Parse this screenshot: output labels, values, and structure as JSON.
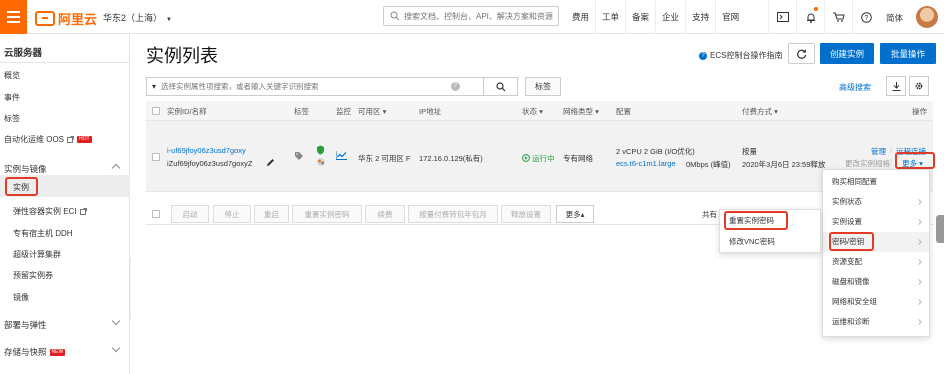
{
  "topbar": {
    "brand": "阿里云",
    "region": "华东2（上海）",
    "search_placeholder": "搜索文档、控制台、API、解决方案和资源",
    "nav": [
      "费用",
      "工单",
      "备案",
      "企业",
      "支持",
      "官网"
    ],
    "icons": [
      "terminal-icon",
      "bell-icon",
      "cart-icon",
      "help-icon"
    ],
    "lang": "简体"
  },
  "sidebar": {
    "title": "云服务器",
    "items": [
      {
        "label": "概览",
        "type": "item"
      },
      {
        "label": "事件",
        "type": "item"
      },
      {
        "label": "标签",
        "type": "item"
      },
      {
        "label": "自动化运维 OOS",
        "type": "item",
        "badge": "HOT",
        "external": true
      },
      {
        "label": "实例与镜像",
        "type": "group",
        "expanded": true
      },
      {
        "label": "实例",
        "type": "sub",
        "active": true
      },
      {
        "label": "弹性容器实例 ECI",
        "type": "sub",
        "external": true
      },
      {
        "label": "专有宿主机 DDH",
        "type": "sub"
      },
      {
        "label": "超级计算集群",
        "type": "sub"
      },
      {
        "label": "预留实例券",
        "type": "sub"
      },
      {
        "label": "镜像",
        "type": "sub"
      },
      {
        "label": "部署与弹性",
        "type": "group",
        "expanded": false
      },
      {
        "label": "存储与快照",
        "type": "group",
        "expanded": false,
        "badge": "NEW"
      }
    ]
  },
  "main": {
    "title": "实例列表",
    "guide_link": "ECS控制台操作指南",
    "create_btn": "创建实例",
    "batch_btn": "批量操作",
    "filter_placeholder": "选择实例属性项搜索，或者输入关键字识别搜索",
    "tag_btn": "标签",
    "advanced_search": "高级搜索"
  },
  "table": {
    "headers": {
      "id_name": "实例ID/名称",
      "tags": "标签",
      "monitor": "监控",
      "zone": "可用区",
      "ip": "IP地址",
      "status": "状态",
      "net_type": "网络类型",
      "config": "配置",
      "billing": "付费方式",
      "actions": "操作"
    },
    "row": {
      "instance_id": "i-uf69jfoy06z3usd7goxy",
      "instance_name": "iZuf69jfoy06z3usd7goxyZ",
      "zone": "华东 2 可用区 F",
      "ip": "172.16.0.129(私有)",
      "status": "运行中",
      "net_type": "专有网络",
      "config_line1": "2 vCPU 2 GiB (I/O优化)",
      "config_type": "ecs.t6-c1m1.large",
      "config_bw": "0Mbps (峰值)",
      "billing_type": "按量",
      "billing_release": "2020年3月6日 23:59释放",
      "action_manage": "管理",
      "action_remote": "远程连接",
      "action_change": "更改实例规格",
      "action_more": "更多"
    },
    "footer_buttons": [
      "启动",
      "停止",
      "重启",
      "重置实例密码",
      "续费",
      "按量付费转包年包月",
      "释放设置",
      "更多"
    ],
    "footer_total": "共有"
  },
  "more_menu": {
    "items": [
      "购买相同配置",
      "实例状态",
      "实例设置",
      "密码/密钥",
      "资源变配",
      "磁盘和镜像",
      "网络和安全组",
      "运维和诊断"
    ],
    "arrows": [
      false,
      true,
      true,
      true,
      true,
      true,
      true,
      true
    ]
  },
  "submenu": {
    "items": [
      "重置实例密码",
      "修改VNC密码"
    ]
  },
  "colors": {
    "brand": "#ff6a00",
    "primary": "#0070cc",
    "highlight": "#e03c28",
    "running": "#22a33a"
  }
}
